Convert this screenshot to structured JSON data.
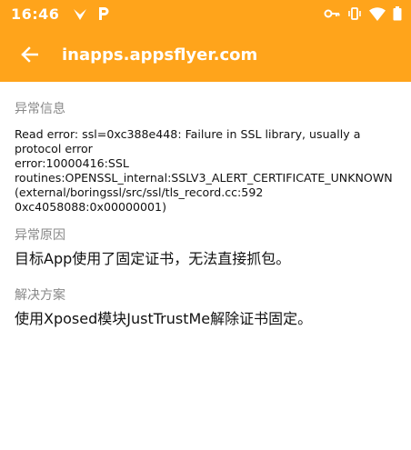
{
  "status_bar": {
    "time": "16:46",
    "left_icons": [
      "twitter-like-bird-icon",
      "p-badge-icon"
    ],
    "right_icons": [
      "key-icon",
      "vibrate-icon",
      "wifi-icon",
      "battery-icon"
    ]
  },
  "app_bar": {
    "title": "inapps.appsflyer.com",
    "back_icon": "arrow-back-icon"
  },
  "sections": {
    "error_info": {
      "label": "异常信息",
      "body": "Read error: ssl=0xc388e448: Failure in SSL library, usually a protocol error\nerror:10000416:SSL routines:OPENSSL_internal:SSLV3_ALERT_CERTIFICATE_UNKNOWN (external/boringssl/src/ssl/tls_record.cc:592 0xc4058088:0x00000001)"
    },
    "cause": {
      "label": "异常原因",
      "body": "目标App使用了固定证书，无法直接抓包。"
    },
    "solution": {
      "label": "解决方案",
      "body": "使用Xposed模块JustTrustMe解除证书固定。"
    }
  },
  "colors": {
    "accent": "#FFA41B",
    "label": "#888888",
    "text": "#111111"
  }
}
